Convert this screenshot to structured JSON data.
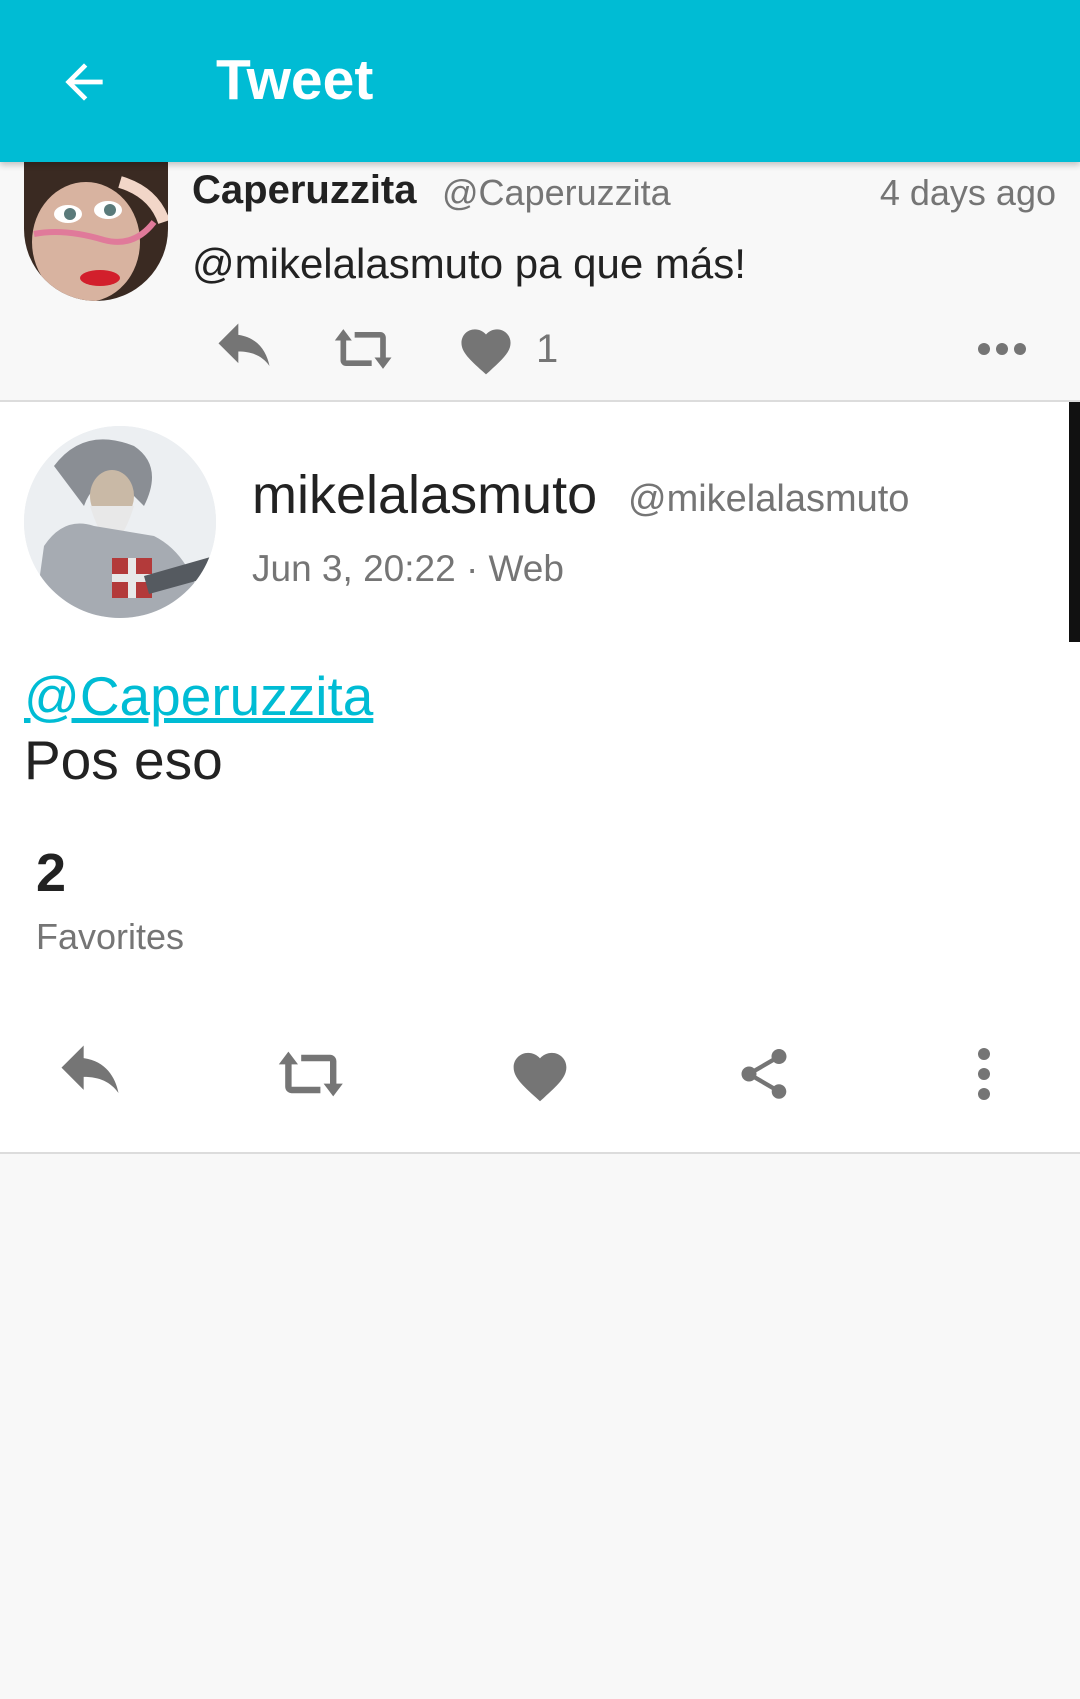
{
  "appbar": {
    "title": "Tweet"
  },
  "reply_tweet": {
    "name": "Caperuzzita",
    "handle": "@Caperuzzita",
    "time": "4 days ago",
    "text": "@mikelalasmuto pa que más!",
    "like_count": "1"
  },
  "main_tweet": {
    "name": "mikelalasmuto",
    "handle": "@mikelalasmuto",
    "meta": "Jun 3, 20:22 · Web",
    "mention": "@Caperuzzita",
    "body": "Pos eso",
    "favorites_count": "2",
    "favorites_label": "Favorites"
  },
  "colors": {
    "accent": "#00bcd4",
    "icon_gray": "#757575"
  },
  "icons": [
    "arrow-back-icon",
    "reply-icon",
    "retweet-icon",
    "heart-icon",
    "more-horiz-icon",
    "share-icon",
    "more-vert-icon"
  ]
}
